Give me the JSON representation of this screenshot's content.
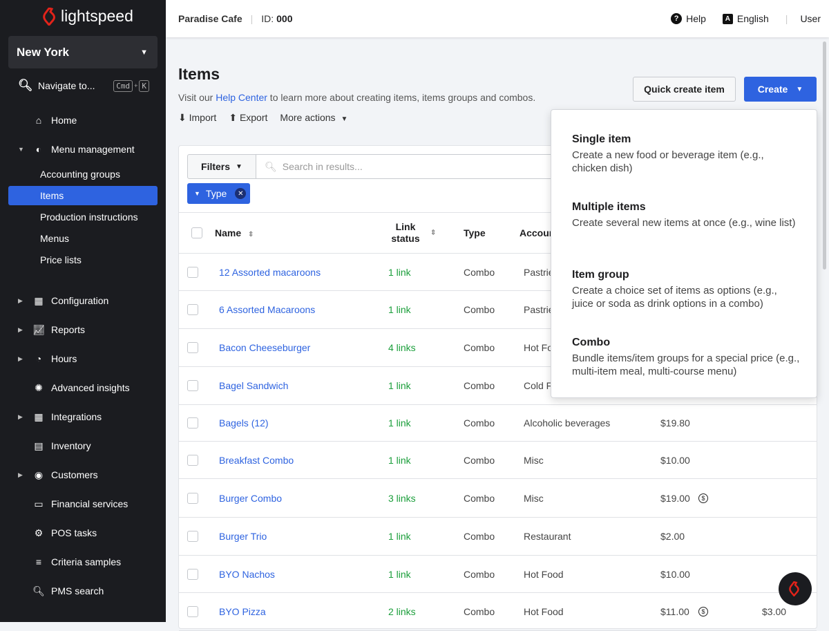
{
  "brand": {
    "name": "lightspeed",
    "color": "#e2231a"
  },
  "sidebar": {
    "location": "New York",
    "navigate": {
      "label": "Navigate to...",
      "kbd1": "Cmd",
      "plus": "+",
      "kbd2": "K"
    },
    "items": [
      {
        "label": "Home",
        "icon": "home-icon"
      },
      {
        "label": "Menu management",
        "icon": "menu-management-icon"
      },
      {
        "label": "Configuration",
        "icon": "configuration-icon"
      },
      {
        "label": "Reports",
        "icon": "reports-icon"
      },
      {
        "label": "Hours",
        "icon": "clock-icon"
      },
      {
        "label": "Advanced insights",
        "icon": "lightbulb-icon"
      },
      {
        "label": "Integrations",
        "icon": "integrations-icon"
      },
      {
        "label": "Inventory",
        "icon": "inventory-icon"
      },
      {
        "label": "Customers",
        "icon": "customers-icon"
      },
      {
        "label": "Financial services",
        "icon": "financial-icon"
      },
      {
        "label": "POS tasks",
        "icon": "gear-icon"
      },
      {
        "label": "Criteria samples",
        "icon": "list-icon"
      },
      {
        "label": "PMS search",
        "icon": "search-icon"
      }
    ],
    "subitems": [
      "Accounting groups",
      "Items",
      "Production instructions",
      "Menus",
      "Price lists"
    ],
    "active": "Items"
  },
  "topbar": {
    "venue": "Paradise Cafe",
    "id_label": "ID:",
    "id_value": "000",
    "help": "Help",
    "language": "English",
    "user": "User"
  },
  "page": {
    "title": "Items",
    "help_pre": "Visit our ",
    "help_link": "Help Center",
    "help_post": " to learn more about creating items, items groups and combos.",
    "import": "Import",
    "export": "Export",
    "more_actions": "More actions",
    "quick_create": "Quick create item",
    "create": "Create"
  },
  "filters": {
    "label": "Filters",
    "search_placeholder": "Search in results...",
    "chip": "Type"
  },
  "table": {
    "headers": {
      "name": "Name",
      "link_status": "Link status",
      "type": "Type",
      "accounting": "Accounting group"
    },
    "rows": [
      {
        "name": "12 Assorted macaroons",
        "link": "1 link",
        "type": "Combo",
        "acct": "Pastries",
        "price": "",
        "coin": false,
        "extra": ""
      },
      {
        "name": "6 Assorted Macaroons",
        "link": "1 link",
        "type": "Combo",
        "acct": "Pastries",
        "price": "",
        "coin": false,
        "extra": ""
      },
      {
        "name": "Bacon Cheeseburger",
        "link": "4 links",
        "type": "Combo",
        "acct": "Hot Food",
        "price": "",
        "coin": false,
        "extra": ""
      },
      {
        "name": "Bagel Sandwich",
        "link": "1 link",
        "type": "Combo",
        "acct": "Cold Food",
        "price": "",
        "coin": false,
        "extra": ""
      },
      {
        "name": "Bagels (12)",
        "link": "1 link",
        "type": "Combo",
        "acct": "Alcoholic beverages",
        "price": "$19.80",
        "coin": false,
        "extra": ""
      },
      {
        "name": "Breakfast Combo",
        "link": "1 link",
        "type": "Combo",
        "acct": "Misc",
        "price": "$10.00",
        "coin": false,
        "extra": ""
      },
      {
        "name": "Burger Combo",
        "link": "3 links",
        "type": "Combo",
        "acct": "Misc",
        "price": "$19.00",
        "coin": true,
        "extra": ""
      },
      {
        "name": "Burger Trio",
        "link": "1 link",
        "type": "Combo",
        "acct": "Restaurant",
        "price": "$2.00",
        "coin": false,
        "extra": ""
      },
      {
        "name": "BYO Nachos",
        "link": "1 link",
        "type": "Combo",
        "acct": "Hot Food",
        "price": "$10.00",
        "coin": false,
        "extra": ""
      },
      {
        "name": "BYO Pizza",
        "link": "2 links",
        "type": "Combo",
        "acct": "Hot Food",
        "price": "$11.00",
        "coin": true,
        "extra": "$3.00"
      }
    ]
  },
  "create_menu": [
    {
      "title": "Single item",
      "desc": "Create a new food or beverage item (e.g., chicken dish)"
    },
    {
      "title": "Multiple items",
      "desc": "Create several new items at once (e.g., wine list)"
    },
    {
      "title": "Item group",
      "desc": "Create a choice set of items as options (e.g., juice or soda as drink options in a combo)"
    },
    {
      "title": "Combo",
      "desc": "Bundle items/item groups for a special price (e.g., multi-item meal, multi-course menu)"
    }
  ],
  "colors": {
    "accent": "#2e63e0",
    "link_green": "#1a9e3a",
    "sidebar": "#1b1c20"
  }
}
